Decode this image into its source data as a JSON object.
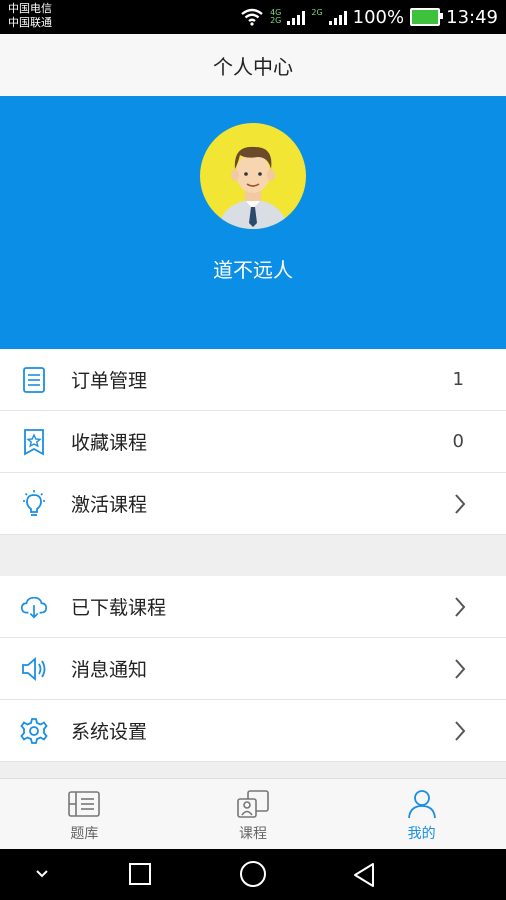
{
  "status_bar": {
    "carrier_1": "中国电信",
    "carrier_2": "中国联通",
    "battery_percent": "100%",
    "time": "13:49"
  },
  "header": {
    "title": "个人中心"
  },
  "profile": {
    "username": "道不远人"
  },
  "menu_group_1": [
    {
      "label": "订单管理",
      "value": "1",
      "icon": "order-list-icon"
    },
    {
      "label": "收藏课程",
      "value": "0",
      "icon": "star-bookmark-icon"
    },
    {
      "label": "激活课程",
      "icon": "lightbulb-icon"
    }
  ],
  "menu_group_2": [
    {
      "label": "已下载课程",
      "icon": "cloud-download-icon"
    },
    {
      "label": "消息通知",
      "icon": "speaker-icon"
    },
    {
      "label": "系统设置",
      "icon": "gear-icon"
    }
  ],
  "tabs": [
    {
      "label": "题库",
      "icon": "question-bank-icon",
      "active": false
    },
    {
      "label": "课程",
      "icon": "course-icon",
      "active": false
    },
    {
      "label": "我的",
      "icon": "person-icon",
      "active": true
    }
  ],
  "colors": {
    "accent": "#0b8fe6",
    "tab_active": "#1a8fe3",
    "avatar_bg": "#f2e533"
  }
}
